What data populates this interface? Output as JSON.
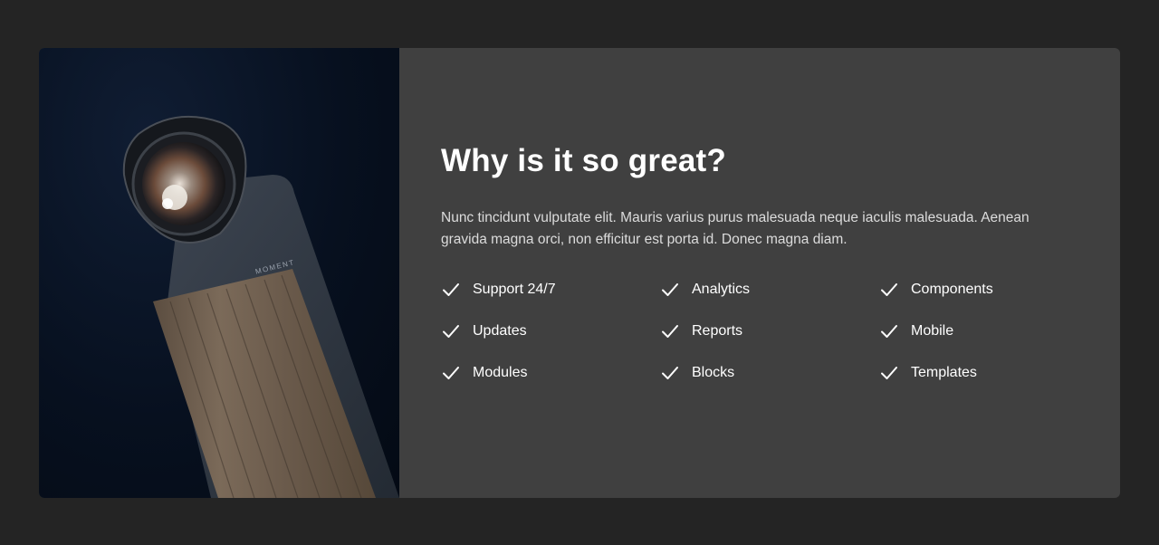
{
  "section": {
    "title": "Why is it so great?",
    "description": "Nunc tincidunt vulputate elit. Mauris varius purus malesuada neque iaculis malesuada. Aenean gravida magna orci, non efficitur est porta id. Donec magna diam.",
    "image": {
      "brand_text": "MOMENT"
    },
    "check_icon": "check-icon",
    "features": [
      {
        "label": "Support 24/7"
      },
      {
        "label": "Analytics"
      },
      {
        "label": "Components"
      },
      {
        "label": "Updates"
      },
      {
        "label": "Reports"
      },
      {
        "label": "Mobile"
      },
      {
        "label": "Modules"
      },
      {
        "label": "Blocks"
      },
      {
        "label": "Templates"
      }
    ]
  },
  "colors": {
    "page_background": "#242424",
    "card_background": "#404040",
    "text": "#ffffff"
  }
}
